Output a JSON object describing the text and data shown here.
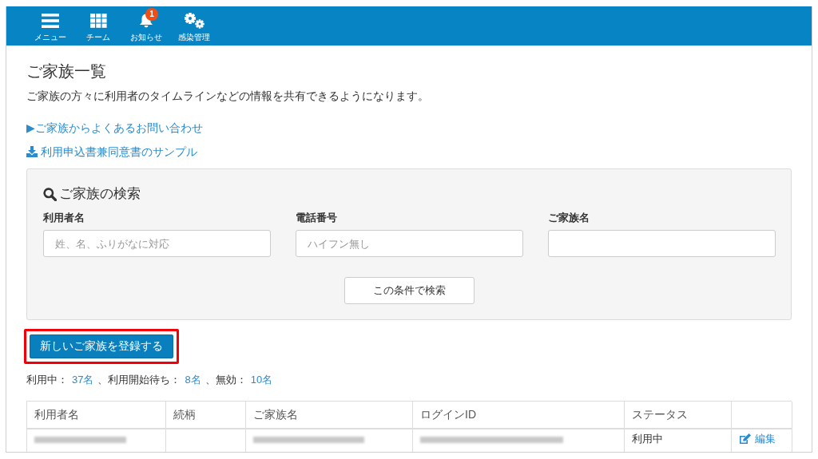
{
  "nav": {
    "items": [
      {
        "kind": "menu",
        "label": "メニュー"
      },
      {
        "kind": "grid",
        "label": "チーム"
      },
      {
        "kind": "bell",
        "label": "お知らせ",
        "badge": "1"
      },
      {
        "kind": "gears",
        "label": "感染管理"
      }
    ]
  },
  "page": {
    "title": "ご家族一覧",
    "description": "ご家族の方々に利用者のタイムラインなどの情報を共有できるようになります。",
    "links": [
      {
        "kind": "toggle",
        "label": "▶ご家族からよくあるお問い合わせ"
      },
      {
        "kind": "download",
        "label": "利用申込書兼同意書のサンプル"
      }
    ]
  },
  "search_panel": {
    "title": "ご家族の検索",
    "fields": [
      {
        "label": "利用者名",
        "placeholder": "姓、名、ふりがなに対応"
      },
      {
        "label": "電話番号",
        "placeholder": "ハイフン無し"
      },
      {
        "label": "ご家族名"
      }
    ],
    "submit": "この条件で検索"
  },
  "register_button": {
    "label": "新しいご家族を登録する",
    "highlighted": true
  },
  "counts": [
    {
      "label": "利用中：",
      "value": "37名"
    },
    {
      "label": "、利用開始待ち：",
      "value": "8名"
    },
    {
      "label": "、無効：",
      "value": "10名"
    }
  ],
  "table": {
    "columns": [
      "利用者名",
      "続柄",
      "ご家族名",
      "ログインID",
      "ステータス"
    ],
    "rows": [
      {
        "cells": [
          {
            "kind": "blurred"
          },
          {
            "kind": "empty"
          },
          {
            "kind": "blurred"
          },
          {
            "kind": "blurred"
          },
          {
            "kind": "text",
            "text": "利用中"
          },
          {
            "kind": "edit_link",
            "text": "編集"
          }
        ]
      }
    ]
  }
}
